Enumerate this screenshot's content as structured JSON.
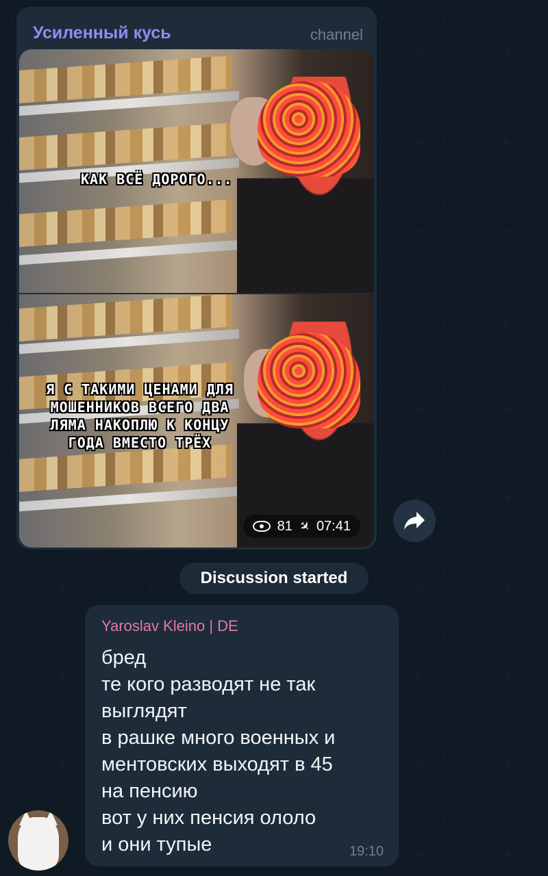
{
  "post": {
    "channel_name": "Усиленный кусь",
    "channel_label": "channel",
    "meme_top_caption": "КАК ВСЁ ДОРОГО...",
    "meme_bottom_caption": "Я С ТАКИМИ ЦЕНАМИ ДЛЯ\nМОШЕННИКОВ ВСЕГО ДВА\nЛЯМА НАКОПЛЮ К КОНЦУ\nГОДА ВМЕСТО ТРЁХ",
    "views": "81",
    "time": "07:41"
  },
  "service_message": "Discussion started",
  "comment": {
    "author": "Yaroslav Kleino | DE",
    "author_color": "#e07aa8",
    "lines": [
      "бред",
      "те кого разводят не так",
      "выглядят",
      "в рашке много военных и",
      "ментовских выходят в 45",
      "на пенсию",
      "вот у них пенсия ололо",
      "и они тупые"
    ],
    "time": "19:10"
  },
  "icons": {
    "views": "eye-icon",
    "pinned": "pin-icon",
    "share": "share-arrow-icon"
  },
  "colors": {
    "background": "#0f1a24",
    "bubble": "#1e2c3a",
    "channel_name": "#8a8ff2"
  }
}
